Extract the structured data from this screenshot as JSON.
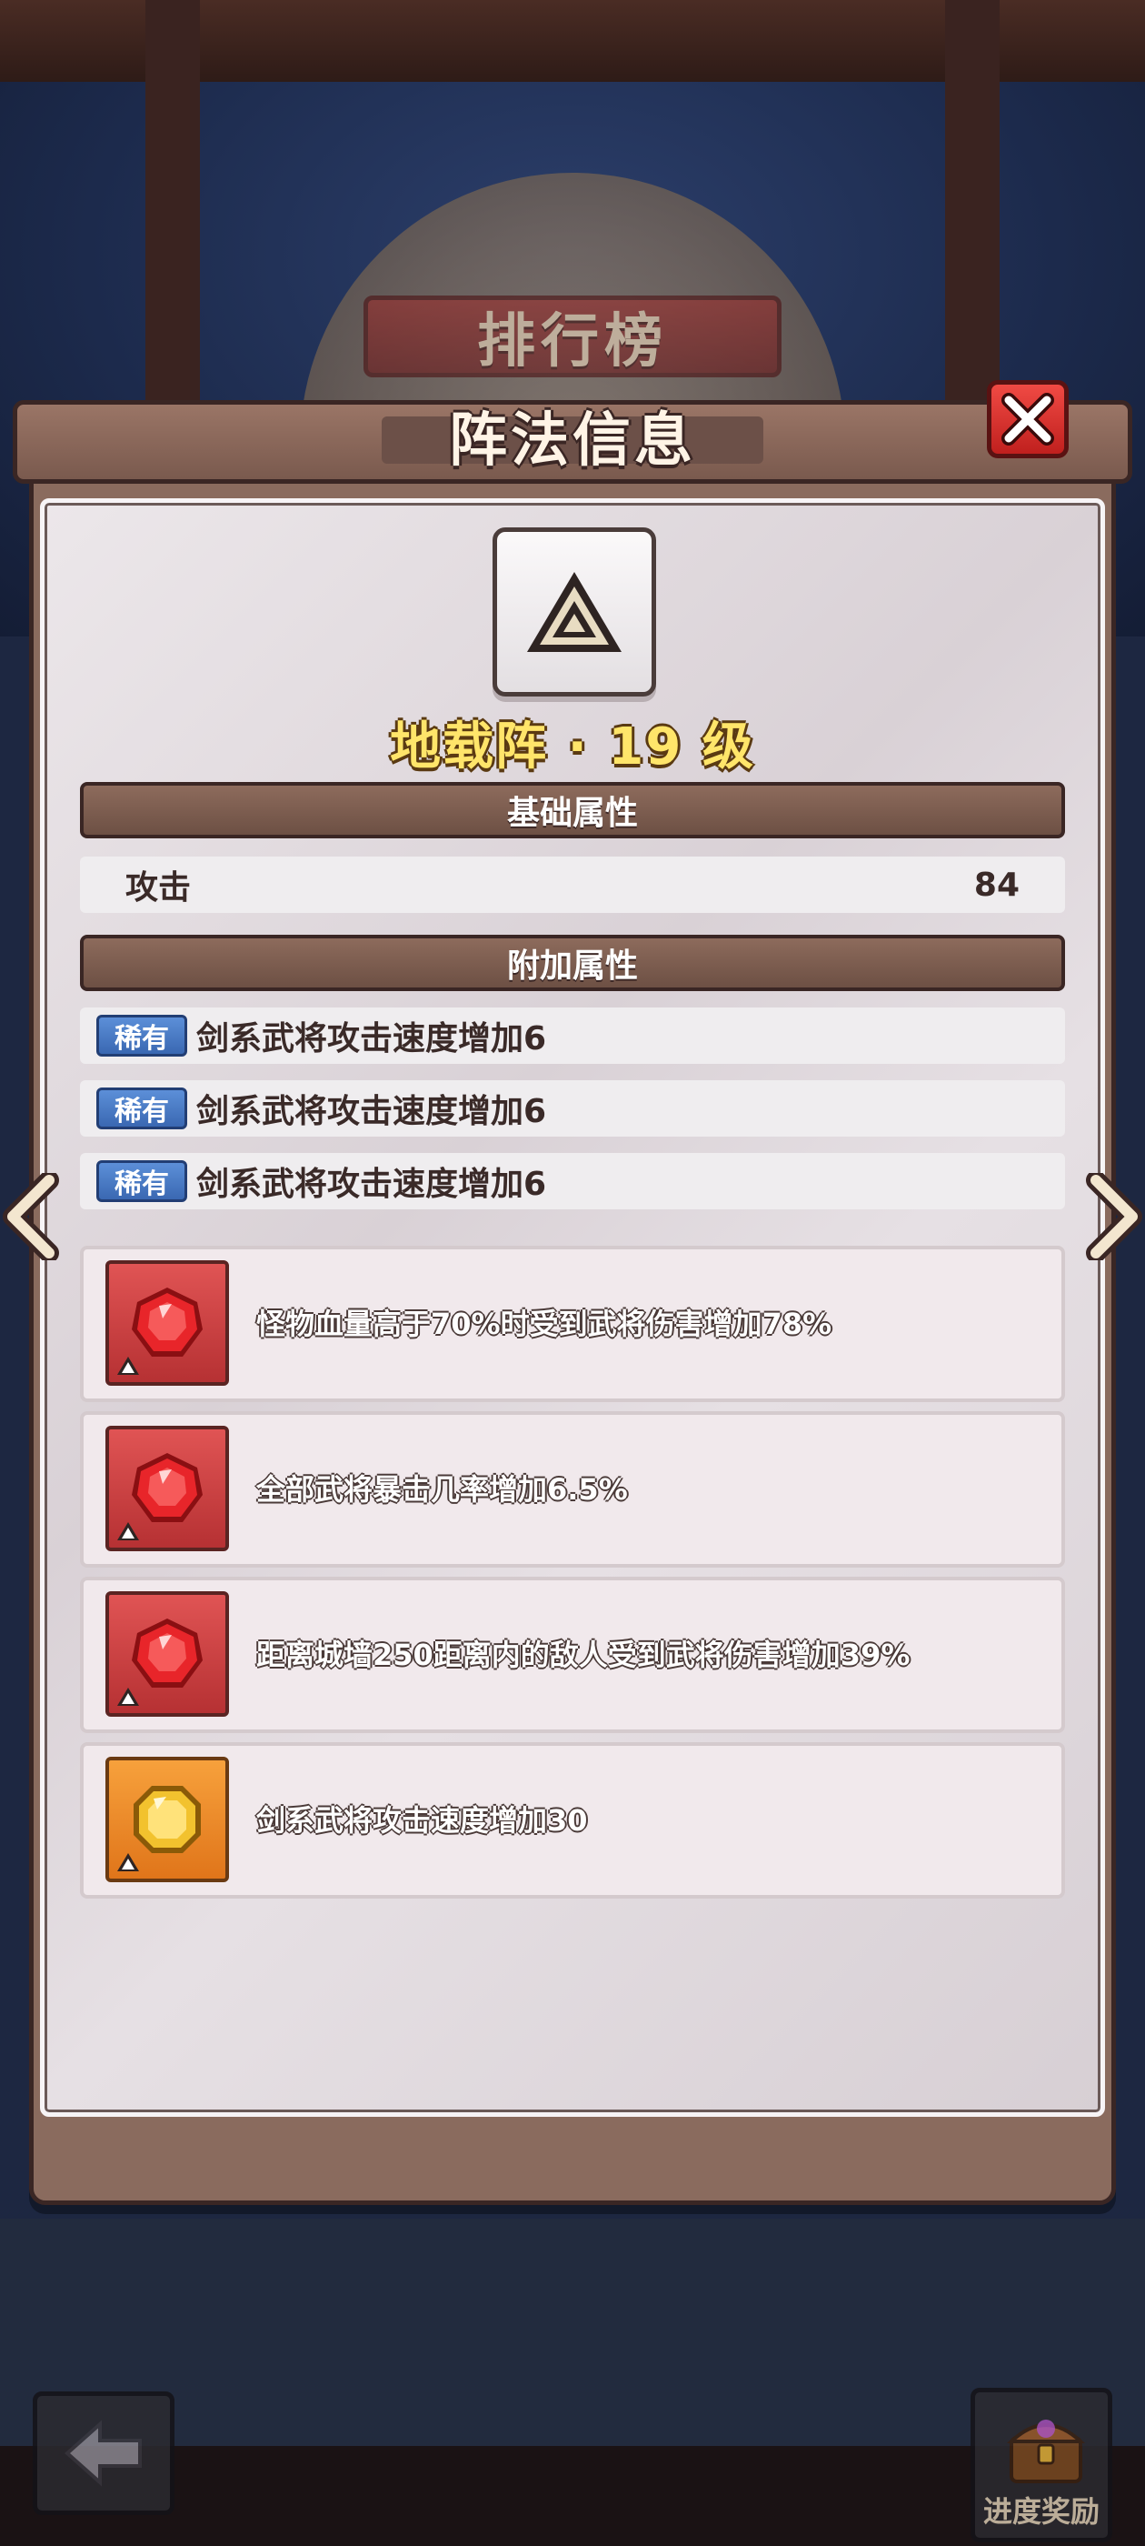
{
  "background": {
    "rank_banner": "排行榜"
  },
  "dialog": {
    "title": "阵法信息",
    "formation_name": "地载阵 · 19 级",
    "base_section_title": "基础属性",
    "base_stats": [
      {
        "label": "攻击",
        "value": "84"
      }
    ],
    "bonus_section_title": "附加属性",
    "bonus_stats": [
      {
        "rarity": "稀有",
        "text": "剑系武将攻击速度增加6"
      },
      {
        "rarity": "稀有",
        "text": "剑系武将攻击速度增加6"
      },
      {
        "rarity": "稀有",
        "text": "剑系武将攻击速度增加6"
      }
    ],
    "gems": [
      {
        "gem_color": "red",
        "icon": "ruby-gem-icon",
        "text": "怪物血量高于70%时受到武将伤害增加78%"
      },
      {
        "gem_color": "red",
        "icon": "ruby-gem-icon",
        "text": "全部武将暴击几率增加6.5%"
      },
      {
        "gem_color": "red",
        "icon": "ruby-gem-icon",
        "text": "距离城墙250距离内的敌人受到武将伤害增加39%"
      },
      {
        "gem_color": "orange",
        "icon": "topaz-gem-icon",
        "text": "剑系武将攻击速度增加30"
      }
    ]
  },
  "bottom_bar": {
    "reward_label": "进度奖励"
  },
  "colors": {
    "panel_brown": "#8a6b5e",
    "title_gold": "#ffe56a",
    "rarity_blue": "#3a68b2",
    "close_red": "#d42a26"
  }
}
